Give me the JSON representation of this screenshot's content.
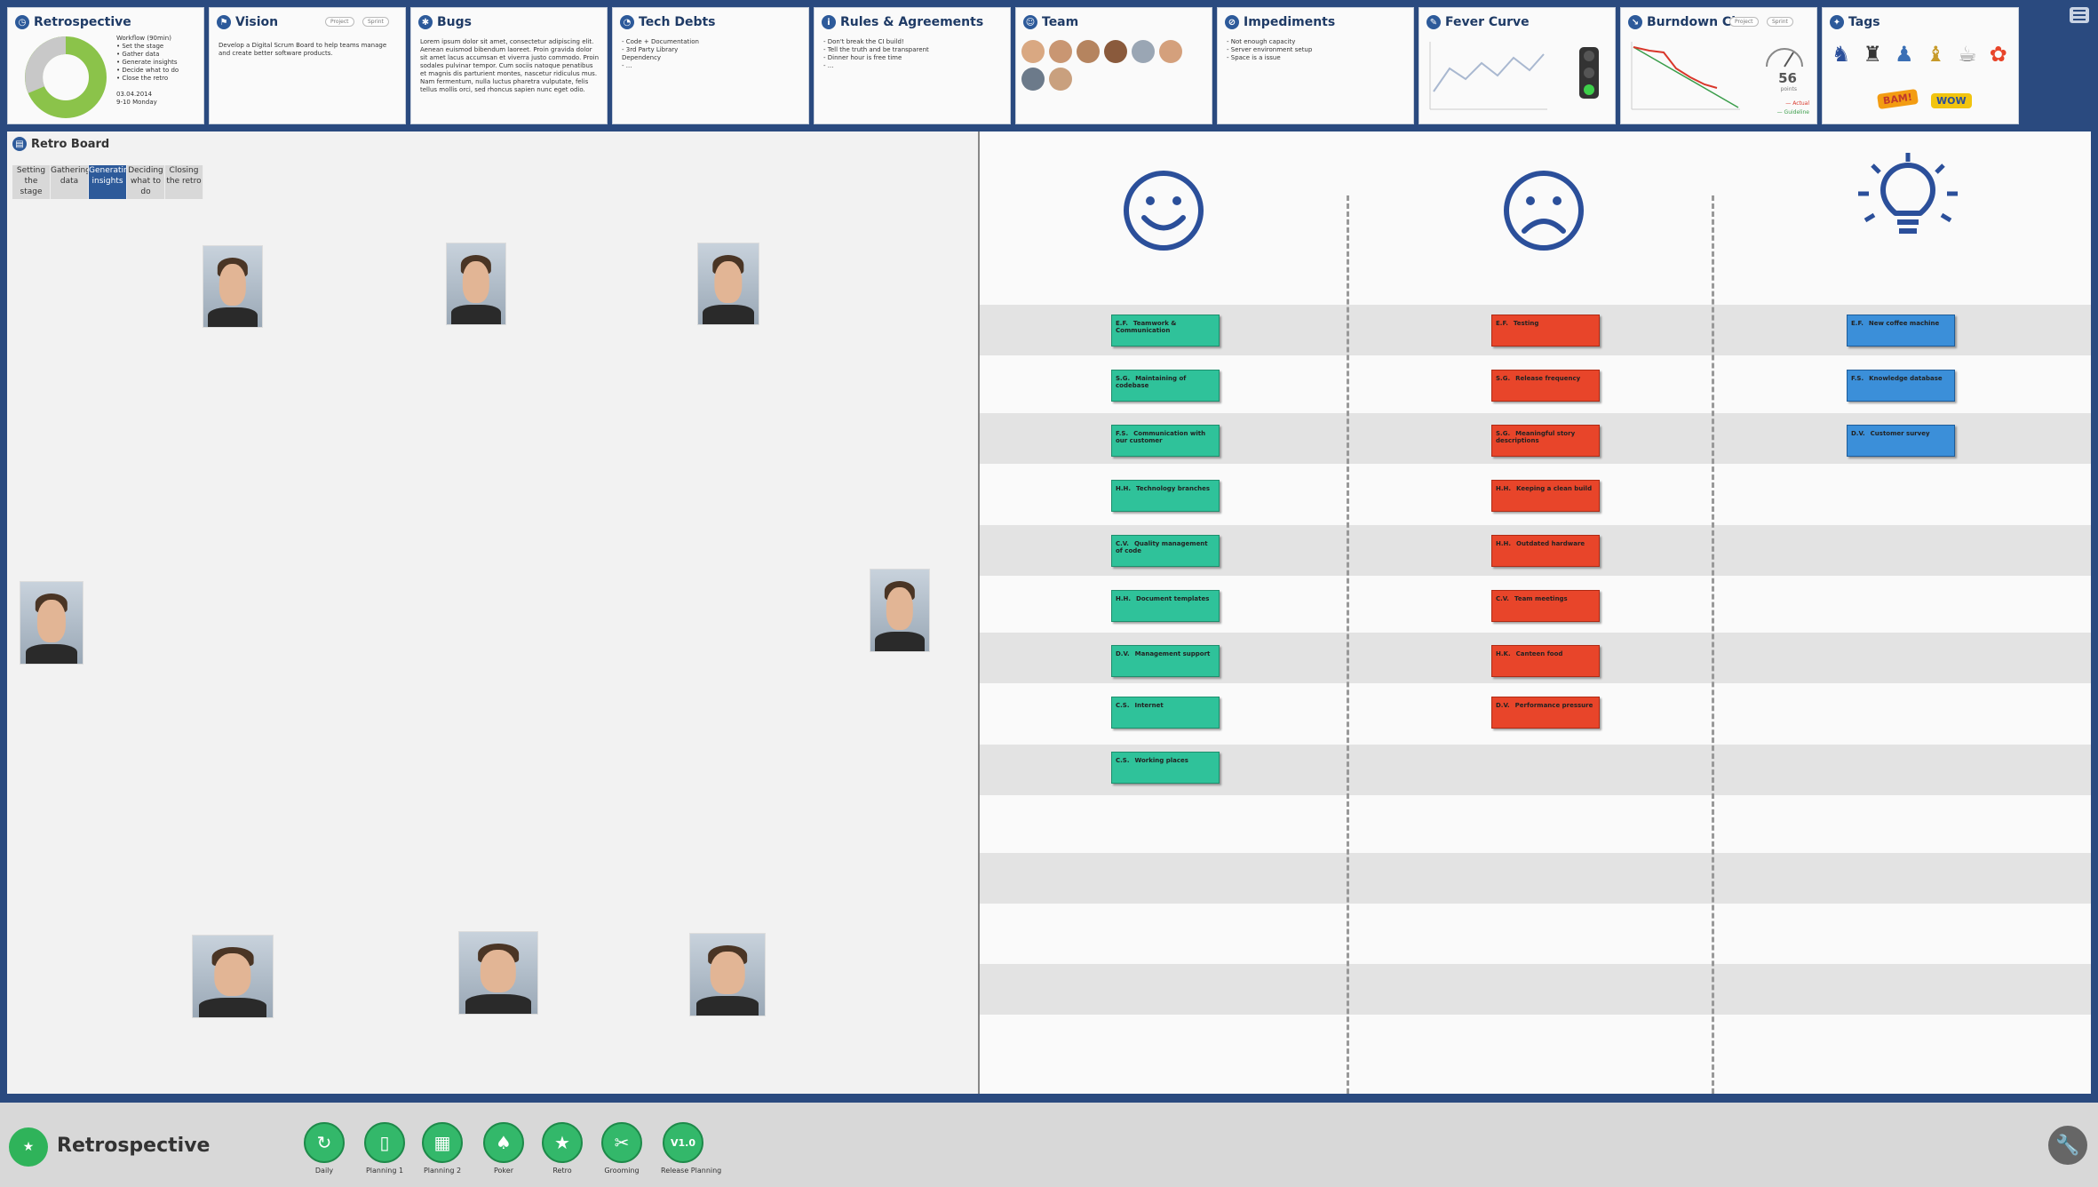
{
  "widgets": {
    "retrospective": {
      "title": "Retrospective",
      "text": "Workflow (90min)\n• Set the stage\n• Gather data\n• Generate insights\n• Decide what to do\n• Close the retro\n\n03.04.2014\n9-10 Monday"
    },
    "vision": {
      "title": "Vision",
      "badge1": "Project",
      "badge2": "Sprint",
      "text": "Develop a Digital Scrum Board to help teams manage and create better software products."
    },
    "bugs": {
      "title": "Bugs",
      "text": "Lorem ipsum dolor sit amet, consectetur adipiscing elit. Aenean euismod bibendum laoreet. Proin gravida dolor sit amet lacus accumsan et viverra justo commodo. Proin sodales pulvinar tempor. Cum sociis natoque penatibus et magnis dis parturient montes, nascetur ridiculus mus. Nam fermentum, nulla luctus pharetra vulputate, felis tellus mollis orci, sed rhoncus sapien nunc eget odio."
    },
    "techdebts": {
      "title": "Tech Debts",
      "text": "- Code + Documentation\n- 3rd Party Library\n  Dependency\n- ..."
    },
    "rules": {
      "title": "Rules & Agreements",
      "text": "- Don't break the CI build!\n- Tell the truth and be transparent\n- Dinner hour is free time\n- ..."
    },
    "team": {
      "title": "Team"
    },
    "impediments": {
      "title": "Impediments",
      "text": "- Not enough capacity\n- Server environment setup\n- Space is a issue"
    },
    "fever": {
      "title": "Fever Curve"
    },
    "burndown": {
      "title": "Burndown Cht",
      "badge1": "Project",
      "badge2": "Sprint",
      "points": "56",
      "points_label": "points",
      "legend1": "Actual",
      "legend2": "Guideline"
    },
    "tags": {
      "title": "Tags",
      "tag1": "BAM!",
      "tag2": "WOW"
    }
  },
  "board": {
    "title": "Retro Board",
    "stages": [
      "Setting the stage",
      "Gathering data",
      "Generating insights",
      "Deciding what to do",
      "Closing the retro"
    ],
    "active_stage": 2
  },
  "cards": {
    "positive": [
      {
        "ini": "E.F.",
        "text": "Teamwork & Communication"
      },
      {
        "ini": "S.G.",
        "text": "Maintaining of codebase"
      },
      {
        "ini": "F.S.",
        "text": "Communication with our customer"
      },
      {
        "ini": "H.H.",
        "text": "Technology branches"
      },
      {
        "ini": "C.V.",
        "text": "Quality management of code"
      },
      {
        "ini": "H.H.",
        "text": "Document templates"
      },
      {
        "ini": "D.V.",
        "text": "Management support"
      },
      {
        "ini": "C.S.",
        "text": "Internet"
      },
      {
        "ini": "C.S.",
        "text": "Working places"
      }
    ],
    "negative": [
      {
        "ini": "E.F.",
        "text": "Testing"
      },
      {
        "ini": "S.G.",
        "text": "Release frequency"
      },
      {
        "ini": "S.G.",
        "text": "Meaningful story descriptions"
      },
      {
        "ini": "H.H.",
        "text": "Keeping a clean build"
      },
      {
        "ini": "H.H.",
        "text": "Outdated hardware"
      },
      {
        "ini": "C.V.",
        "text": "Team meetings"
      },
      {
        "ini": "H.K.",
        "text": "Canteen food"
      },
      {
        "ini": "D.V.",
        "text": "Performance pressure"
      }
    ],
    "ideas": [
      {
        "ini": "E.F.",
        "text": "New coffee machine"
      },
      {
        "ini": "F.S.",
        "text": "Knowledge database"
      },
      {
        "ini": "D.V.",
        "text": "Customer survey"
      }
    ]
  },
  "bottom": {
    "title": "Retrospective",
    "nav": [
      {
        "label": "Daily",
        "icon": "refresh-icon"
      },
      {
        "label": "Planning 1",
        "icon": "book-icon"
      },
      {
        "label": "Planning 2",
        "icon": "board-icon"
      },
      {
        "label": "Poker",
        "icon": "cards-icon"
      },
      {
        "label": "Retro",
        "icon": "stars-icon"
      },
      {
        "label": "Grooming",
        "icon": "tools-icon"
      },
      {
        "label": "Release Planning",
        "icon": "version-icon",
        "glyph": "V1.0"
      }
    ]
  },
  "colors": {
    "frame": "#2a4a7f",
    "green_card": "#2fc29a",
    "red_card": "#e8452a",
    "blue_card": "#3b8fd9",
    "accent": "#2d5a9a"
  }
}
